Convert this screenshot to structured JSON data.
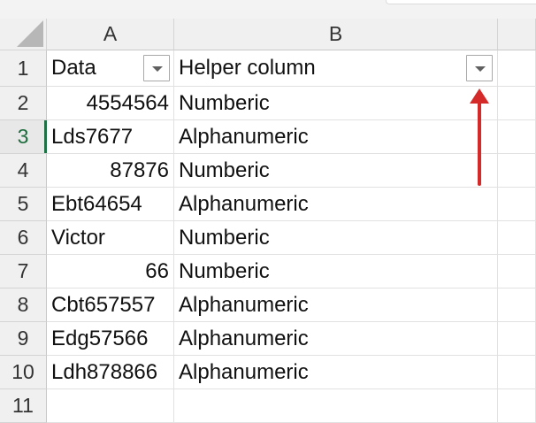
{
  "columns": [
    "A",
    "B"
  ],
  "row_numbers": [
    "1",
    "2",
    "3",
    "4",
    "5",
    "6",
    "7",
    "8",
    "9",
    "10",
    "11"
  ],
  "selected_row": "3",
  "header_row": {
    "a": "Data",
    "b": "Helper column"
  },
  "rows": [
    {
      "a": "4554564",
      "b": "Numberic"
    },
    {
      "a": "Lds7677",
      "b": "Alphanumeric"
    },
    {
      "a": "87876",
      "b": "Numberic"
    },
    {
      "a": "Ebt64654",
      "b": "Alphanumeric"
    },
    {
      "a": "Victor",
      "b": "Numberic"
    },
    {
      "a": "66",
      "b": "Numberic"
    },
    {
      "a": "Cbt657557",
      "b": "Alphanumeric"
    },
    {
      "a": "Edg57566",
      "b": "Alphanumeric"
    },
    {
      "a": "Ldh878866",
      "b": "Alphanumeric"
    }
  ],
  "annotation_color": "#d42a2a",
  "icons": {
    "filter": "filter-dropdown-icon",
    "annotation": "red-arrow-up"
  }
}
